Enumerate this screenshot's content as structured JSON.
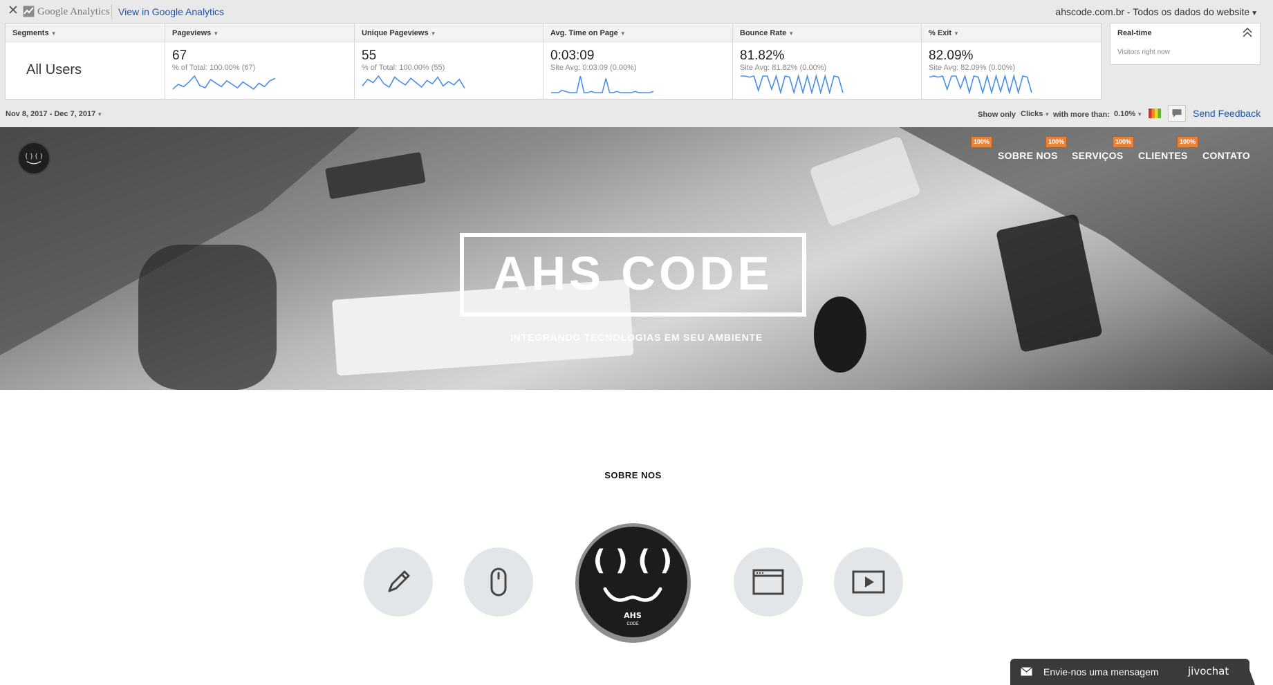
{
  "ga": {
    "close_glyph": "✕",
    "brand": "Google Analytics",
    "view_link": "View in Google Analytics",
    "site_selector": "ahscode.com.br - Todos os dados do website",
    "segments_label": "Segments",
    "segment_value": "All Users",
    "metrics": [
      {
        "label": "Pageviews",
        "value": "67",
        "sub": "% of Total: 100.00% (67)",
        "spark": [
          3,
          7,
          5,
          9,
          14,
          6,
          4,
          11,
          8,
          5,
          10,
          7,
          4,
          9,
          6,
          3,
          8,
          5,
          10,
          12
        ]
      },
      {
        "label": "Unique Pageviews",
        "value": "55",
        "sub": "% of Total: 100.00% (55)",
        "spark": [
          6,
          12,
          9,
          15,
          8,
          5,
          14,
          10,
          7,
          13,
          9,
          5,
          11,
          8,
          14,
          6,
          10,
          7,
          12,
          4
        ]
      },
      {
        "label": "Avg. Time on Page",
        "value": "0:03:09",
        "sub": "Site Avg: 0:03:09 (0.00%)",
        "spark": [
          0,
          0,
          0,
          2,
          1,
          0,
          0,
          0,
          14,
          0,
          0,
          1,
          0,
          0,
          0,
          12,
          0,
          0,
          1,
          0,
          0,
          0,
          0,
          1,
          0,
          0,
          0,
          0,
          1
        ]
      },
      {
        "label": "Bounce Rate",
        "value": "81.82%",
        "sub": "Site Avg: 81.82% (0.00%)",
        "spark": [
          15,
          15,
          14,
          15,
          2,
          15,
          15,
          3,
          15,
          0,
          15,
          14,
          0,
          15,
          0,
          15,
          0,
          15,
          0,
          15,
          0,
          15,
          14,
          0
        ]
      },
      {
        "label": "% Exit",
        "value": "82.09%",
        "sub": "Site Avg: 82.09% (0.00%)",
        "spark": [
          14,
          15,
          14,
          15,
          3,
          15,
          15,
          4,
          15,
          0,
          15,
          14,
          0,
          15,
          0,
          15,
          1,
          15,
          0,
          15,
          0,
          15,
          14,
          0
        ]
      }
    ],
    "spark_color": "#4a8ee8",
    "realtime_title": "Real-time",
    "realtime_sub": "Visitors right now",
    "date_range": "Nov 8, 2017 - Dec 7, 2017",
    "show_only": "Show only",
    "clicks_select": "Clicks",
    "with_more_than": "with more than:",
    "threshold_select": "0.10%",
    "feedback": "Send Feedback",
    "link_color": "#1a55a8"
  },
  "site": {
    "nav": [
      {
        "label": "SOBRE NOS",
        "badge": "100%"
      },
      {
        "label": "SERVIÇOS",
        "badge": "100%"
      },
      {
        "label": "CLIENTES",
        "badge": "100%"
      },
      {
        "label": "CONTATO",
        "badge": "100%"
      }
    ],
    "badge_color": "#e8823a",
    "hero_title": "AHS CODE",
    "hero_tagline": "INTEGRANDO TECNOLOGIAS EM SEU AMBIENTE",
    "section_title": "SOBRE NOS",
    "feature_icons": [
      "pencil-icon",
      "mouse-icon",
      "browser-window-icon",
      "play-icon"
    ],
    "logo_text": "AHS",
    "logo_subtext": "CODE",
    "chat_text": "Envie-nos uma mensagem",
    "chat_brand": "jivochat"
  }
}
